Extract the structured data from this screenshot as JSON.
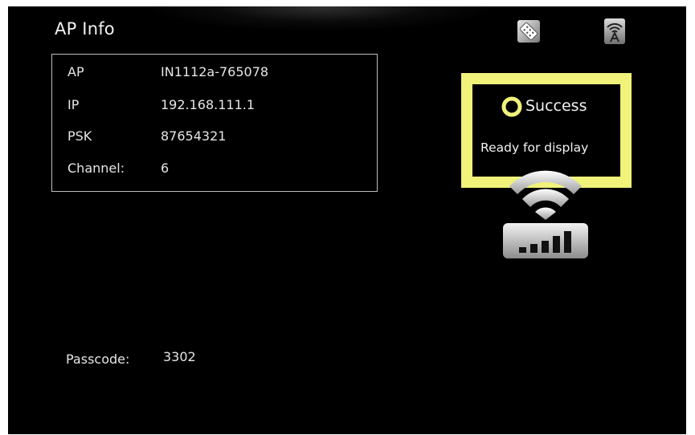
{
  "header": {
    "title": "AP Info"
  },
  "ap_info": {
    "rows": [
      {
        "label": "AP",
        "value": "IN1112a-765078"
      },
      {
        "label": "IP",
        "value": "192.168.111.1"
      },
      {
        "label": "PSK",
        "value": "87654321"
      },
      {
        "label": "Channel:",
        "value": "6"
      }
    ]
  },
  "status": {
    "title": "Success",
    "subtitle": "Ready for display",
    "accent_color": "#f0f27a"
  },
  "passcode": {
    "label": "Passcode:",
    "value": "3302"
  },
  "icons": {
    "top_left": "remote-control-icon",
    "top_right": "wifi-antenna-icon",
    "status": "status-ring-icon",
    "signal": "wifi-signal-icon",
    "device": "router-signal-strength-icon"
  },
  "signal": {
    "bars_filled": 5,
    "bars_total": 5
  }
}
